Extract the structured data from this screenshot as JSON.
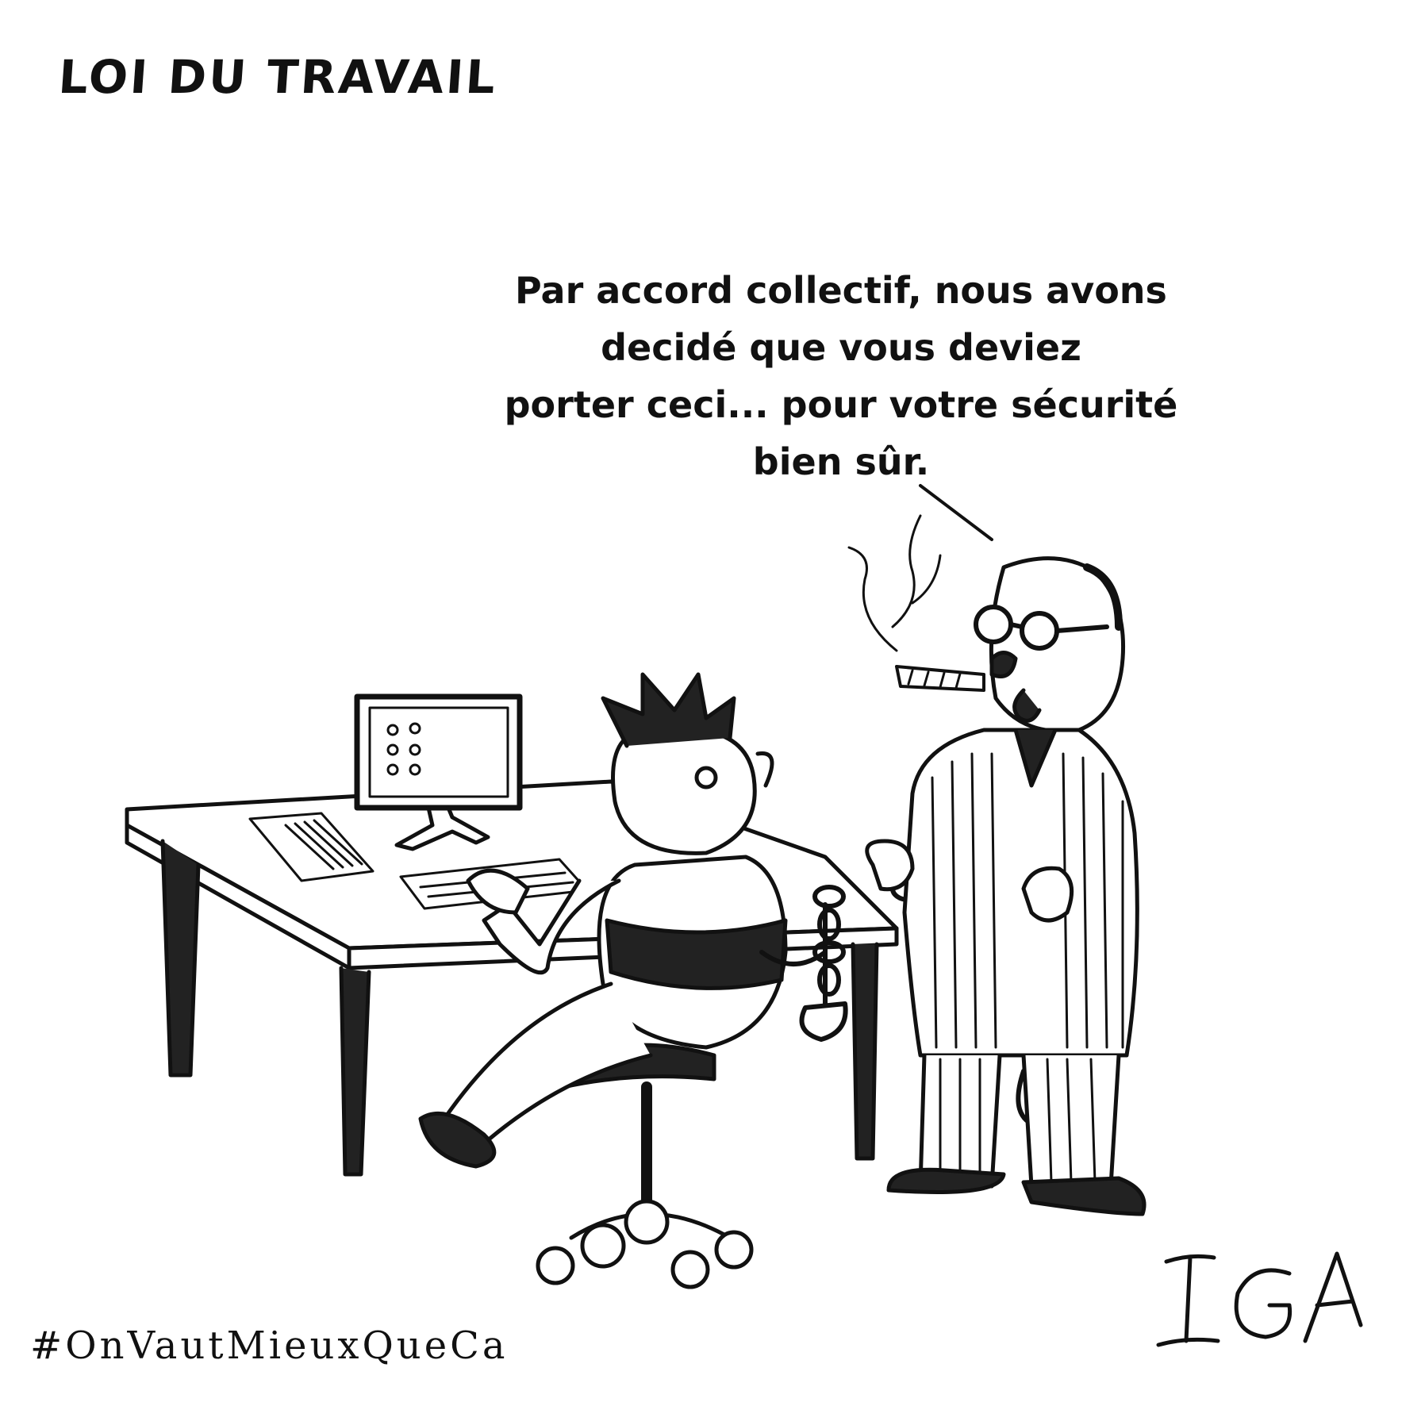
{
  "title": "LOI DU TRAVAIL",
  "speech_lines": [
    "Par accord collectif, nous avons",
    "decidé que vous deviez",
    "porter ceci... pour votre sécurité",
    "bien sûr."
  ],
  "hashtag": "#OnVautMieuxQueCa",
  "signature": "IGA"
}
